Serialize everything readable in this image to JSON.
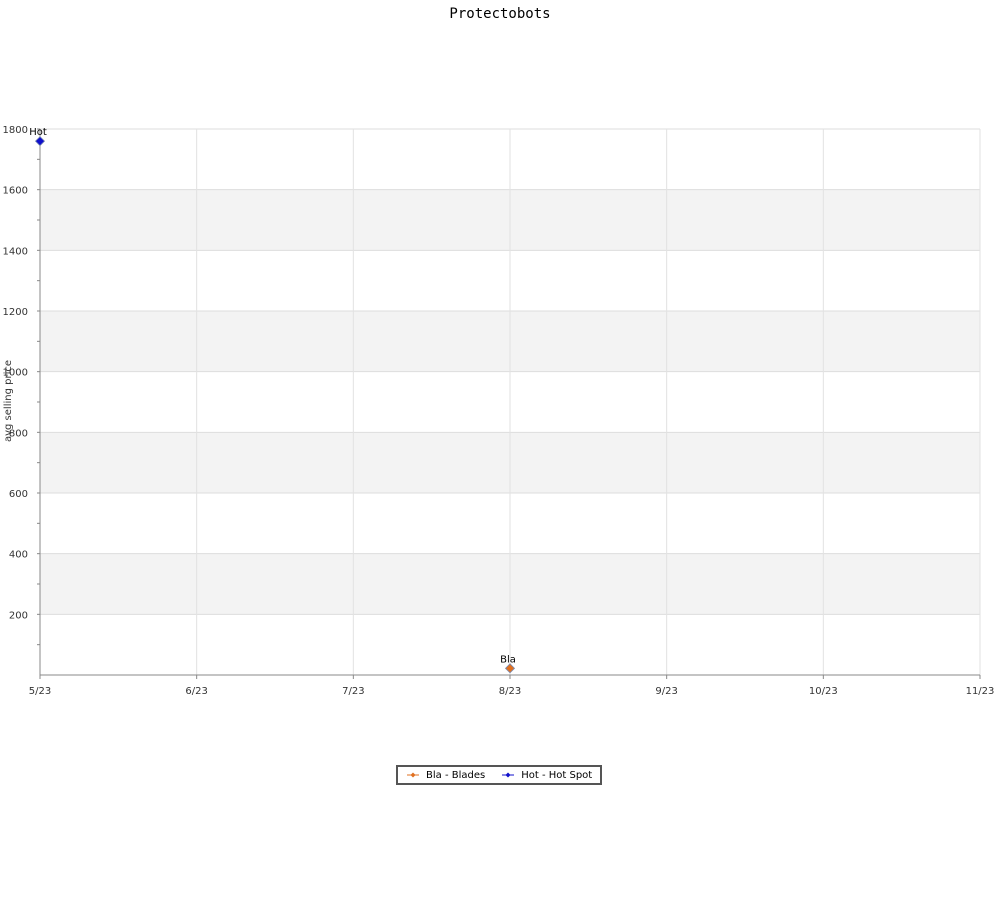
{
  "chart_data": {
    "type": "scatter",
    "title": "Protectobots",
    "ylabel": "avg selling price",
    "xlabel": "",
    "x_ticks": [
      "5/23",
      "6/23",
      "7/23",
      "8/23",
      "9/23",
      "10/23",
      "11/23"
    ],
    "xlim": [
      "5/23",
      "11/23"
    ],
    "y_ticks": [
      200,
      400,
      600,
      800,
      1000,
      1200,
      1400,
      1600,
      1800
    ],
    "ylim": [
      0,
      1800
    ],
    "grid": true,
    "alternating_bands": true,
    "legend_placement": "bottom-center",
    "series": [
      {
        "name": "Bla - Blades",
        "color": "#e07020",
        "points": [
          {
            "x": "8/23",
            "y": 22,
            "label": "Bla"
          }
        ]
      },
      {
        "name": "Hot - Hot Spot",
        "color": "#1010cc",
        "points": [
          {
            "x": "5/23",
            "y": 1760,
            "label": "Hot"
          }
        ]
      }
    ]
  }
}
